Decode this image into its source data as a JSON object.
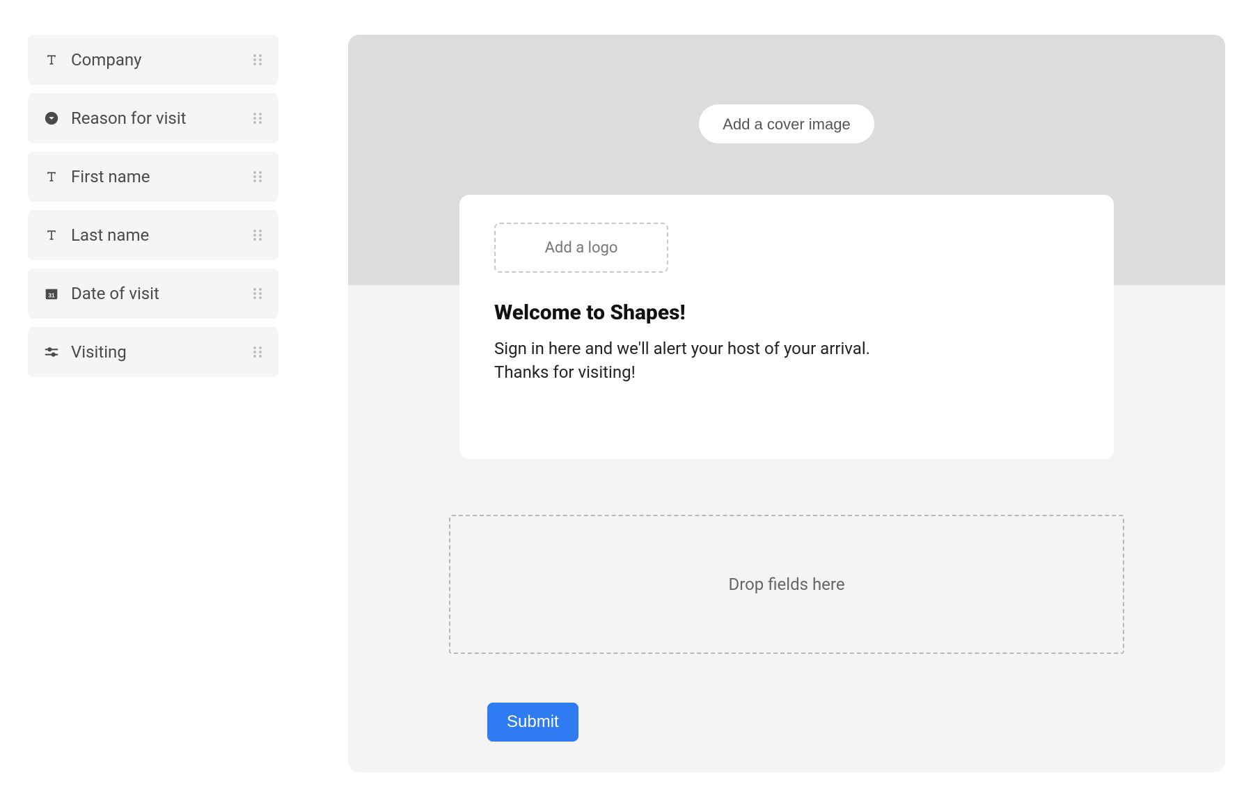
{
  "sidebar": {
    "fields": [
      {
        "icon": "text",
        "label": "Company"
      },
      {
        "icon": "dropdown",
        "label": "Reason for visit"
      },
      {
        "icon": "text",
        "label": "First name"
      },
      {
        "icon": "text",
        "label": "Last name"
      },
      {
        "icon": "date",
        "label": "Date of visit"
      },
      {
        "icon": "slider",
        "label": "Visiting"
      }
    ]
  },
  "canvas": {
    "cover_button": "Add a cover image",
    "logo_button": "Add a logo",
    "welcome_title": "Welcome to Shapes!",
    "welcome_body_line1": "Sign in here and we'll alert your host of your arrival.",
    "welcome_body_line2": "Thanks for visiting!",
    "drop_zone": "Drop fields here",
    "submit": "Submit"
  }
}
